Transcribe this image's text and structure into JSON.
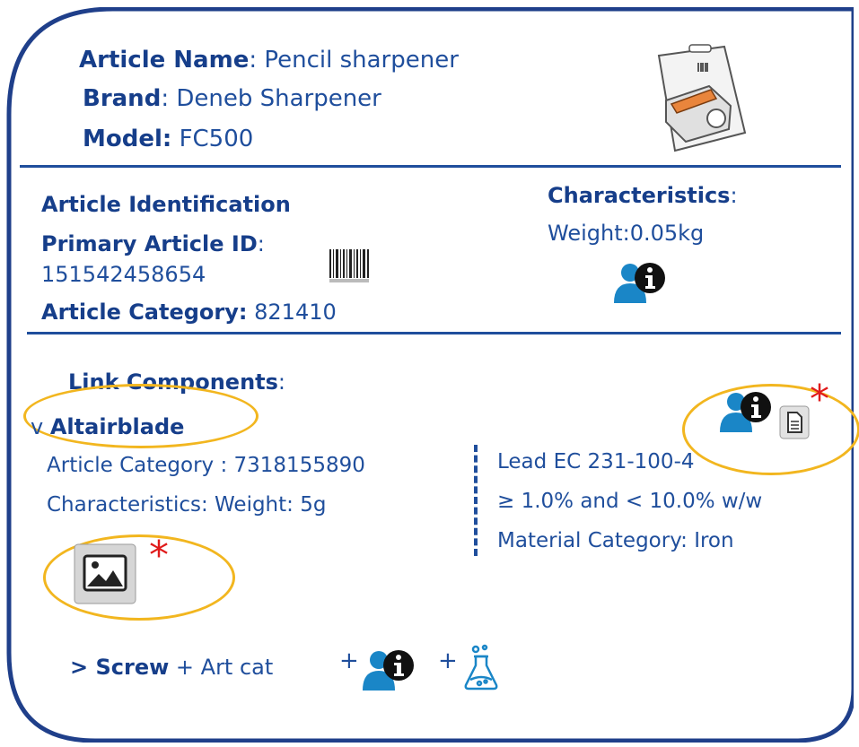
{
  "header": {
    "article_name_label": "Article Name",
    "article_name_value": "Pencil sharpener",
    "brand_label": "Brand",
    "brand_value": "Deneb Sharpener",
    "model_label": "Model:",
    "model_value": "FC500"
  },
  "identification": {
    "title": "Article Identification",
    "primary_id_label": "Primary Article ID",
    "primary_id_value": "151542458654",
    "category_label": "Article Category:",
    "category_value": "821410"
  },
  "characteristics": {
    "title": "Characteristics",
    "weight": "Weight:0.05kg"
  },
  "links": {
    "title": "Link Components",
    "toggle_open": "v",
    "component": "Altairblade",
    "category": "Article Category : 7318155890",
    "characteristics": "Characteristics: Weight: 5g",
    "substance_line1": "Lead EC 231-100-4",
    "substance_line2": "≥ 1.0% and < 10.0% w/w",
    "substance_line3": "Material Category: Iron",
    "required_mark": "*",
    "screw_toggle": "> Screw",
    "screw_suffix": "+ Art cat",
    "plus": "+"
  },
  "colors": {
    "primary": "#1f4e9c",
    "highlight": "#f2b61f",
    "required": "#e01b1b",
    "icon_blue": "#1a86c7"
  },
  "icons": [
    "product-image-icon",
    "barcode-icon",
    "user-info-icon",
    "document-icon",
    "image-icon",
    "flask-icon"
  ]
}
